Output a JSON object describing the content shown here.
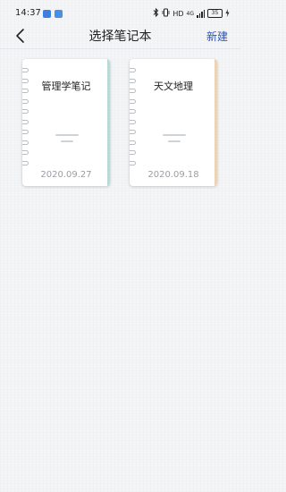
{
  "status_bar": {
    "time": "14:37",
    "network": "HD",
    "signal": "4G",
    "battery": "35"
  },
  "header": {
    "title": "选择笔记本",
    "back_icon": "chevron-left-icon",
    "new_label": "新建"
  },
  "notebooks": [
    {
      "title": "管理学笔记",
      "date": "2020.09.27",
      "spine_color": "#b9dad6"
    },
    {
      "title": "天文地理",
      "date": "2020.09.18",
      "spine_color": "#ecd3b5"
    }
  ],
  "colors": {
    "accent": "#2b55b8",
    "background": "#f4f5f7"
  }
}
